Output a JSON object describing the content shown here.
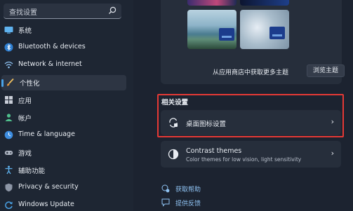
{
  "search": {
    "placeholder": "查找设置"
  },
  "sidebar": {
    "items": [
      {
        "label": "系统",
        "icon": "monitor-icon"
      },
      {
        "label": "Bluetooth & devices",
        "icon": "bluetooth-icon"
      },
      {
        "label": "Network & internet",
        "icon": "wifi-icon"
      },
      {
        "label": "个性化",
        "icon": "brush-icon",
        "active": true
      },
      {
        "label": "应用",
        "icon": "apps-icon"
      },
      {
        "label": "帐户",
        "icon": "person-icon"
      },
      {
        "label": "Time & language",
        "icon": "globe-clock-icon"
      },
      {
        "label": "游戏",
        "icon": "gamepad-icon"
      },
      {
        "label": "辅助功能",
        "icon": "accessibility-icon"
      },
      {
        "label": "Privacy & security",
        "icon": "shield-icon"
      },
      {
        "label": "Windows Update",
        "icon": "update-icon"
      }
    ]
  },
  "themes_panel": {
    "store_text": "从应用商店中获取更多主题",
    "browse_button": "浏览主题"
  },
  "related": {
    "title": "相关设置",
    "desktop_icons": {
      "label": "桌面图标设置",
      "icon": "desktop-icons-icon"
    },
    "contrast": {
      "title": "Contrast themes",
      "subtitle": "Color themes for low vision, light sensitivity",
      "icon": "contrast-icon"
    }
  },
  "links": {
    "help": "获取帮助",
    "feedback": "提供反馈"
  },
  "colors": {
    "accent": "#4aa3e8",
    "highlight_border": "#e53935",
    "background": "#1c2330",
    "card": "#262e3b"
  }
}
